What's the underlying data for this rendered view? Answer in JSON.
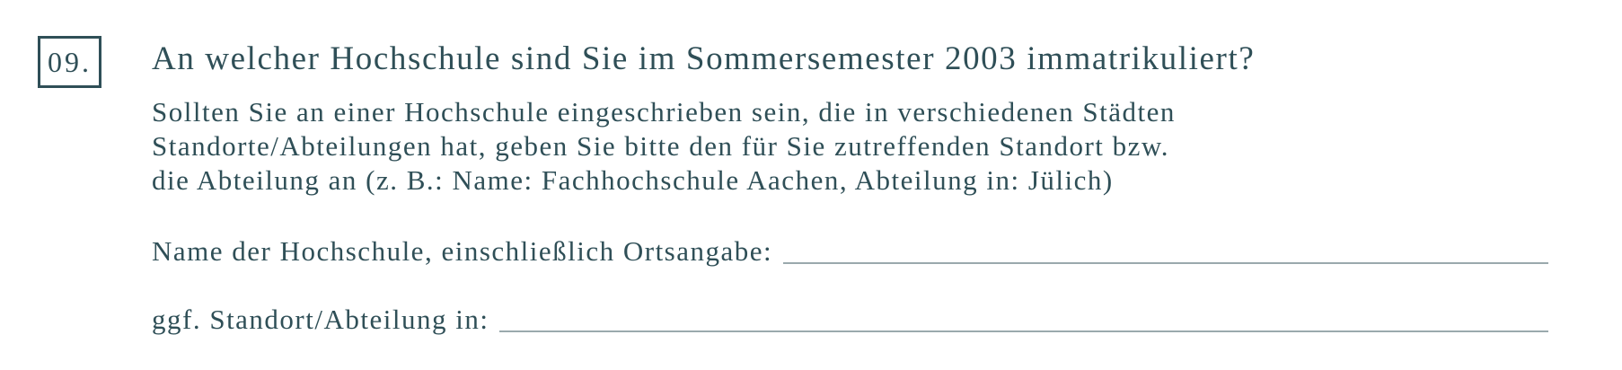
{
  "question": {
    "number": "09.",
    "title": "An welcher Hochschule sind Sie im Sommersemester 2003 immatrikuliert?",
    "instructions": [
      "Sollten Sie an einer Hochschule eingeschrieben sein, die in verschiedenen Städten",
      "Standorte/Abteilungen hat, geben Sie bitte den für Sie zutreffenden Standort bzw.",
      "die Abteilung an (z. B.: Name: Fachhochschule Aachen, Abteilung in: Jülich)"
    ]
  },
  "fields": [
    {
      "label": "Name der Hochschule, einschließlich Ortsangabe:",
      "value": ""
    },
    {
      "label": "ggf. Standort/Abteilung in:",
      "value": ""
    }
  ]
}
